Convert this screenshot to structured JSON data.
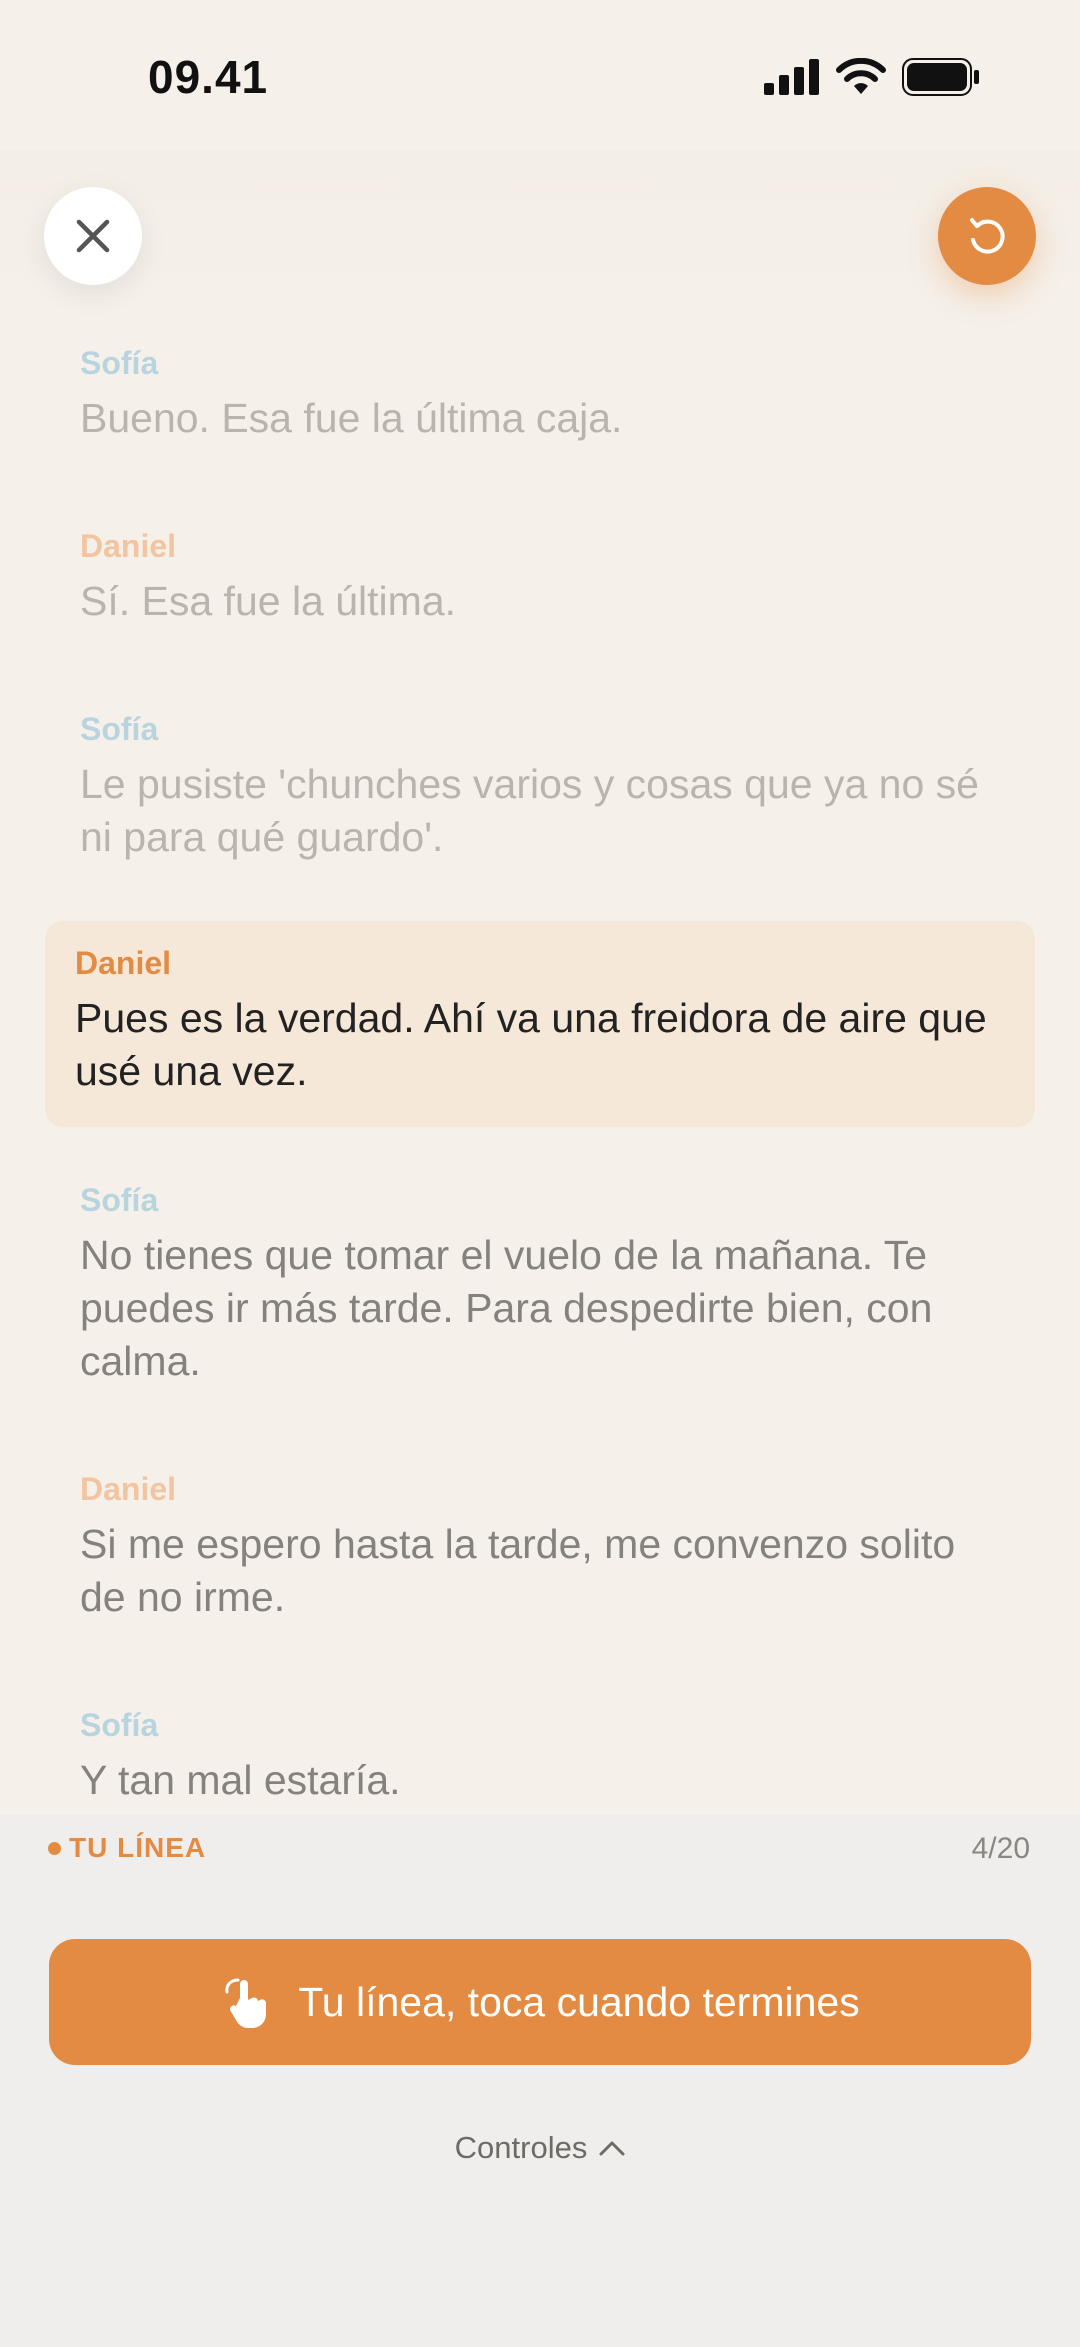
{
  "status_bar": {
    "time": "09.41",
    "icons": [
      "cellular-signal-icon",
      "wifi-icon",
      "battery-icon"
    ]
  },
  "header": {
    "close_icon": "close-icon",
    "restart_icon": "restart-icon"
  },
  "script": {
    "lines": [
      {
        "speaker": "Sofía",
        "text": "Bueno. Esa fue la última caja.",
        "state": "past"
      },
      {
        "speaker": "Daniel",
        "text": "Sí. Esa fue la última.",
        "state": "past"
      },
      {
        "speaker": "Sofía",
        "text": "Le pusiste 'chunches varios y cosas que ya no sé ni para qué guardo'.",
        "state": "past"
      },
      {
        "speaker": "Daniel",
        "text": "Pues es la verdad. Ahí va una freidora de aire que usé una vez.",
        "state": "current"
      },
      {
        "speaker": "Sofía",
        "text": "No tienes que tomar el vuelo de la mañana. Te puedes ir más tarde. Para despedirte bien, con calma.",
        "state": "upcoming"
      },
      {
        "speaker": "Daniel",
        "text": "Si me espero hasta la tarde, me convenzo solito de no irme.",
        "state": "upcoming"
      },
      {
        "speaker": "Sofía",
        "text": "Y tan mal estaría.",
        "state": "upcoming"
      }
    ]
  },
  "footer": {
    "section_label": "TU LÍNEA",
    "counter": "4/20",
    "main_button_label": "Tu línea, toca cuando termines",
    "main_button_icon": "tap-hand-icon",
    "controls_label": "Controles",
    "controls_icon": "chevron-up-icon"
  },
  "colors": {
    "accent": "#e48b43",
    "sofia": "#b7d4df",
    "daniel": "#f2c4a0",
    "highlight": "#f5e8d9",
    "background": "#f5f0ea"
  }
}
